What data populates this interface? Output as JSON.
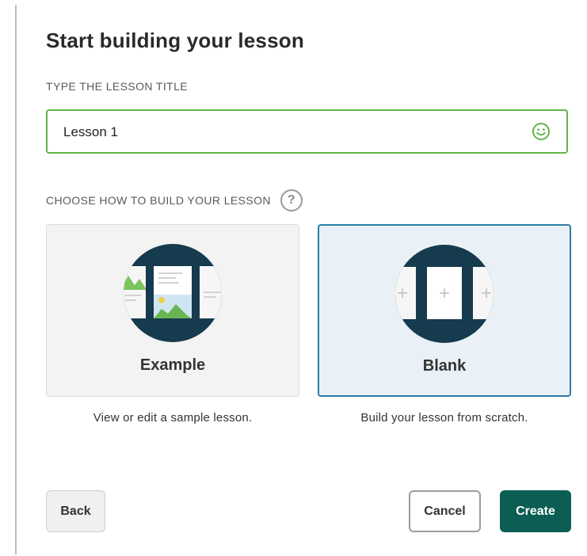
{
  "dialog": {
    "title": "Start building your lesson"
  },
  "lesson_title": {
    "label": "TYPE THE LESSON TITLE",
    "value": "Lesson 1",
    "status_icon": "smile-icon",
    "status_color": "#62b34c"
  },
  "build_method": {
    "label": "CHOOSE HOW TO BUILD YOUR LESSON",
    "help_icon": "question-mark-icon",
    "help_glyph": "?",
    "selected": "blank",
    "options": [
      {
        "id": "example",
        "name": "Example",
        "description": "View or edit a sample lesson.",
        "icon": "example-lesson-icon"
      },
      {
        "id": "blank",
        "name": "Blank",
        "description": "Build your lesson from scratch.",
        "icon": "blank-lesson-icon"
      }
    ]
  },
  "footer": {
    "back_label": "Back",
    "cancel_label": "Cancel",
    "create_label": "Create"
  },
  "colors": {
    "accent_green": "#62b34c",
    "selected_border": "#2e7ca3",
    "selected_bg": "#e9f1f6",
    "primary_button": "#0c5e54",
    "illustration_dark": "#163a4e"
  }
}
